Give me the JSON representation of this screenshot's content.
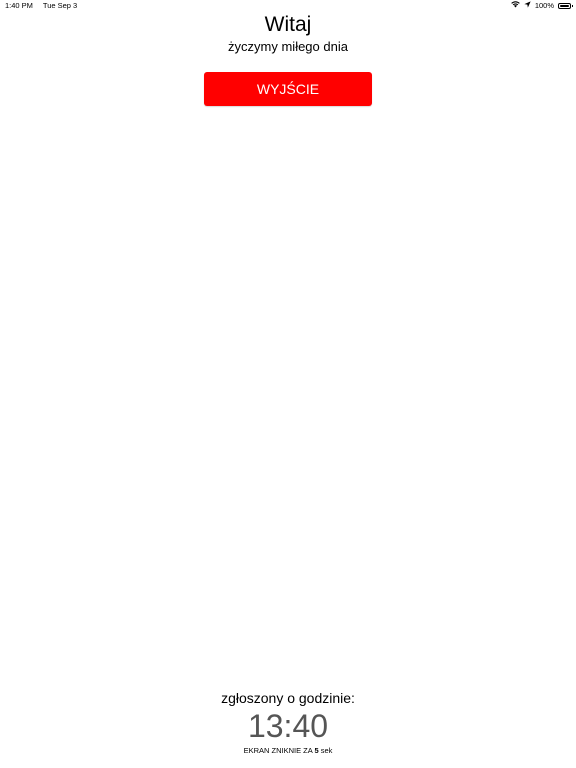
{
  "status_bar": {
    "time": "1:40 PM",
    "date": "Tue Sep 3",
    "battery_percent": "100%",
    "icons": [
      "wifi-icon",
      "location-arrow-icon",
      "battery-icon"
    ]
  },
  "header": {
    "title": "Witaj",
    "subtitle": "życzymy miłego dnia"
  },
  "exit_button": {
    "label": "WYJŚCIE",
    "color": "#ff0000"
  },
  "footer": {
    "reported_label": "zgłoszony o godzinie:",
    "reported_time": "13:40",
    "countdown_prefix": "EKRAN ZNIKNIE ZA",
    "countdown_value": "5",
    "countdown_suffix": "sek"
  }
}
